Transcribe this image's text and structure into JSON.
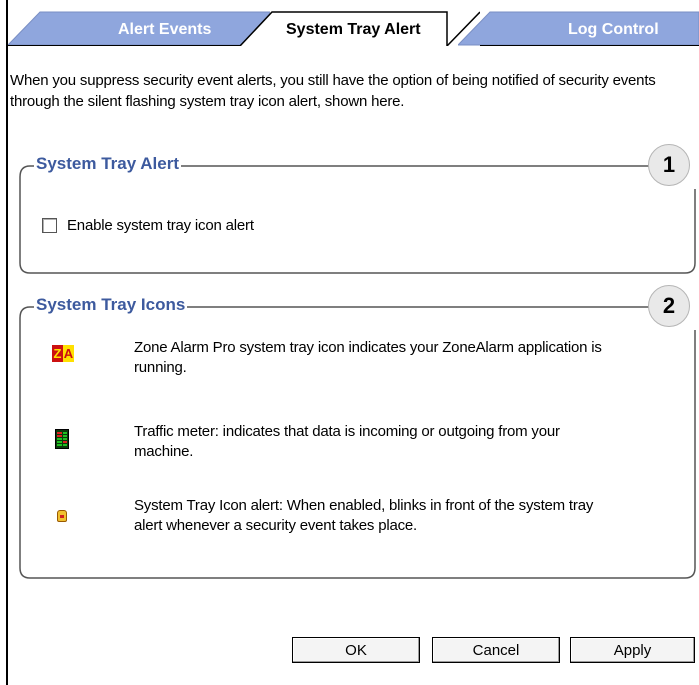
{
  "tabs": [
    {
      "label": "Alert Events",
      "active": false
    },
    {
      "label": "System Tray Alert",
      "active": true
    },
    {
      "label": "Log Control",
      "active": false
    }
  ],
  "intro_text": "When you suppress security event alerts, you still have the option of being notified of security events through the silent flashing system tray icon alert, shown here.",
  "system_tray_alert_group": {
    "title": "System Tray Alert",
    "badge": "1",
    "checkbox": {
      "label": "Enable system tray icon alert",
      "checked": false
    }
  },
  "system_tray_icons_group": {
    "title": "System Tray Icons",
    "badge": "2",
    "items": [
      {
        "icon": "zonealarm-icon",
        "description": "Zone Alarm Pro system tray icon indicates your ZoneAlarm application is running."
      },
      {
        "icon": "traffic-meter-icon",
        "description": "Traffic meter: indicates that data is incoming or outgoing from your machine."
      },
      {
        "icon": "tray-alert-icon",
        "description": "System Tray Icon alert: When enabled, blinks in front of the system tray alert whenever a security event takes place."
      }
    ]
  },
  "buttons": {
    "ok": "OK",
    "cancel": "Cancel",
    "apply": "Apply"
  },
  "colors": {
    "tab_inactive": "#8fa6dd",
    "tab_active": "#ffffff",
    "group_title": "#3d5a9e"
  }
}
